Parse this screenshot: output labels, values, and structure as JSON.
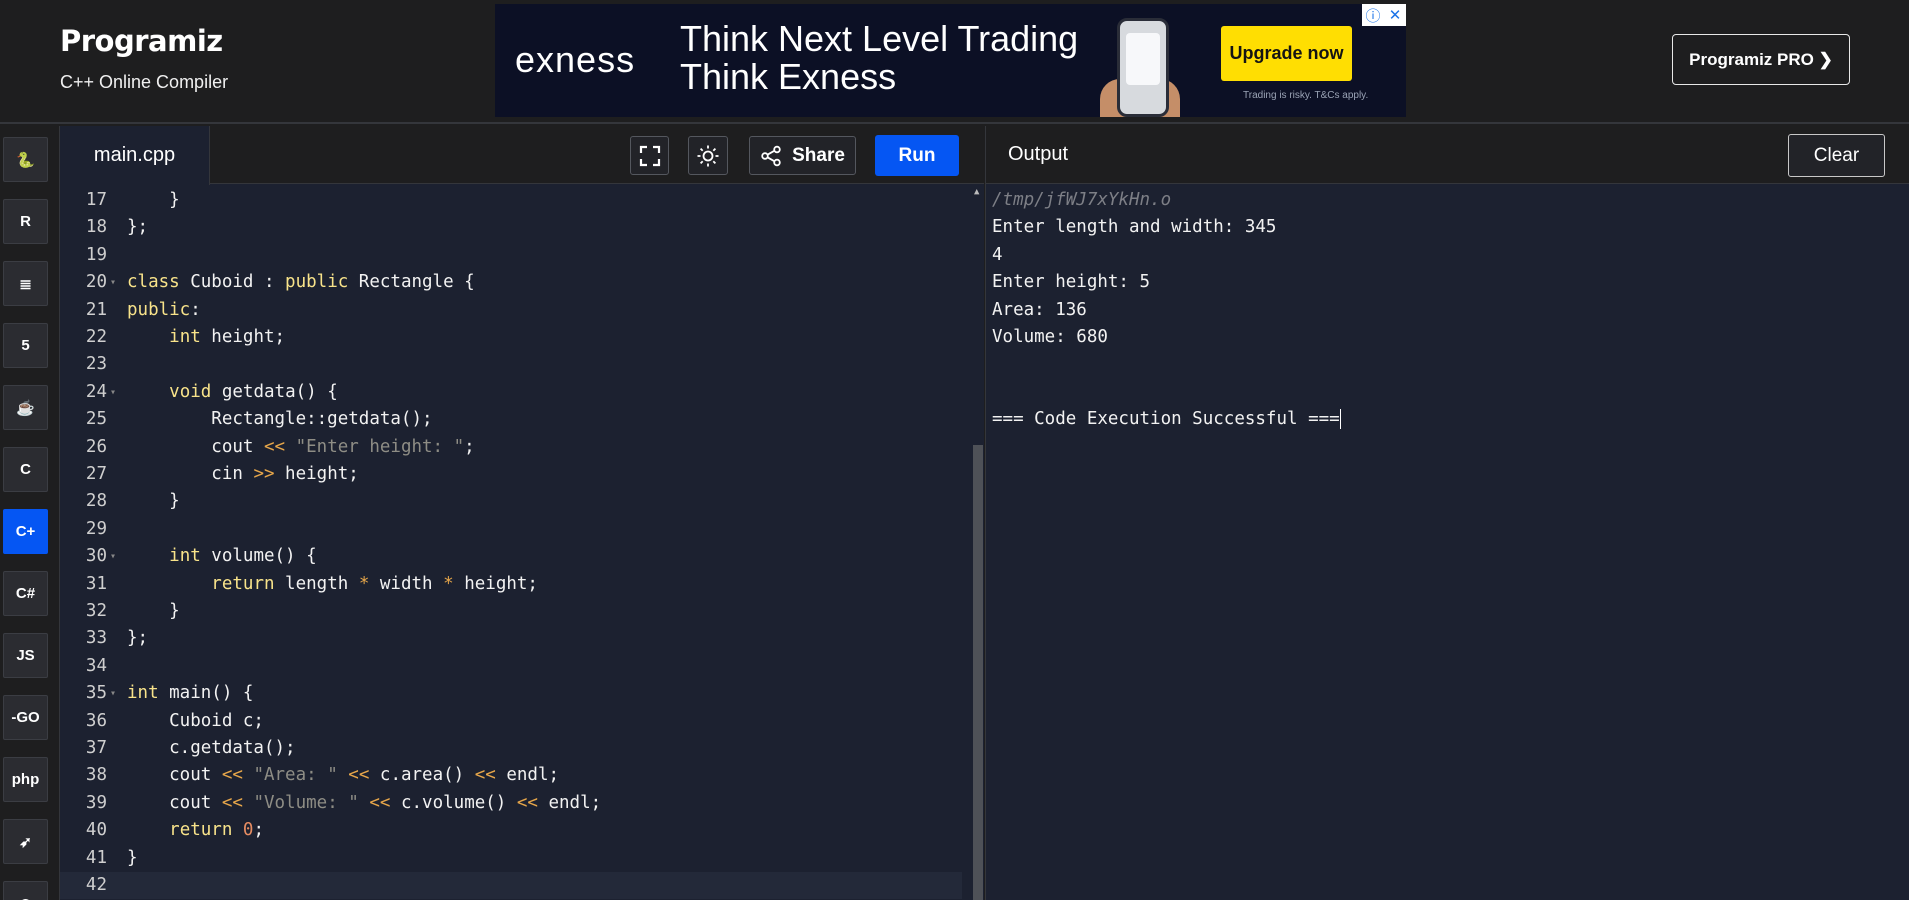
{
  "header": {
    "logo": "Programiz",
    "subtitle": "C++ Online Compiler",
    "pro_button": "Programiz PRO ❯"
  },
  "ad": {
    "brand": "exness",
    "line1": "Think Next Level Trading",
    "line2": "Think Exness",
    "cta": "Upgrade now",
    "risk": "Trading is risky. T&Cs apply."
  },
  "sidebar": {
    "languages": [
      {
        "name": "python",
        "glyph": "🐍"
      },
      {
        "name": "r",
        "glyph": "R"
      },
      {
        "name": "sql",
        "glyph": "≣"
      },
      {
        "name": "html",
        "glyph": "5"
      },
      {
        "name": "java",
        "glyph": "☕"
      },
      {
        "name": "c",
        "glyph": "C"
      },
      {
        "name": "cpp",
        "glyph": "C+",
        "active": true
      },
      {
        "name": "csharp",
        "glyph": "C#"
      },
      {
        "name": "javascript",
        "glyph": "JS"
      },
      {
        "name": "go",
        "glyph": "-GO"
      },
      {
        "name": "php",
        "glyph": "php"
      },
      {
        "name": "swift",
        "glyph": "➶"
      },
      {
        "name": "more",
        "glyph": "◎"
      }
    ]
  },
  "editor": {
    "file_tab": "main.cpp",
    "share_label": "Share",
    "run_label": "Run",
    "lines": [
      {
        "n": "17",
        "code": "    }"
      },
      {
        "n": "18",
        "code": "};"
      },
      {
        "n": "19",
        "code": ""
      },
      {
        "n": "20",
        "code": "class Cuboid : public Rectangle {",
        "fold": true
      },
      {
        "n": "21",
        "code": "public:"
      },
      {
        "n": "22",
        "code": "    int height;"
      },
      {
        "n": "23",
        "code": ""
      },
      {
        "n": "24",
        "code": "    void getdata() {",
        "fold": true
      },
      {
        "n": "25",
        "code": "        Rectangle::getdata();"
      },
      {
        "n": "26",
        "code": "        cout << \"Enter height: \";"
      },
      {
        "n": "27",
        "code": "        cin >> height;"
      },
      {
        "n": "28",
        "code": "    }"
      },
      {
        "n": "29",
        "code": ""
      },
      {
        "n": "30",
        "code": "    int volume() {",
        "fold": true
      },
      {
        "n": "31",
        "code": "        return length * width * height;"
      },
      {
        "n": "32",
        "code": "    }"
      },
      {
        "n": "33",
        "code": "};"
      },
      {
        "n": "34",
        "code": ""
      },
      {
        "n": "35",
        "code": "int main() {",
        "fold": true
      },
      {
        "n": "36",
        "code": "    Cuboid c;"
      },
      {
        "n": "37",
        "code": "    c.getdata();"
      },
      {
        "n": "38",
        "code": "    cout << \"Area: \" << c.area() << endl;"
      },
      {
        "n": "39",
        "code": "    cout << \"Volume: \" << c.volume() << endl;"
      },
      {
        "n": "40",
        "code": "    return 0;"
      },
      {
        "n": "41",
        "code": "}"
      },
      {
        "n": "42",
        "code": "",
        "current": true
      }
    ]
  },
  "output": {
    "title": "Output",
    "clear_label": "Clear",
    "lines": [
      "/tmp/jfWJ7xYkHn.o",
      "Enter length and width: 345",
      "4",
      "Enter height: 5",
      "Area: 136",
      "Volume: 680",
      "",
      "",
      "=== Code Execution Successful ==="
    ]
  }
}
